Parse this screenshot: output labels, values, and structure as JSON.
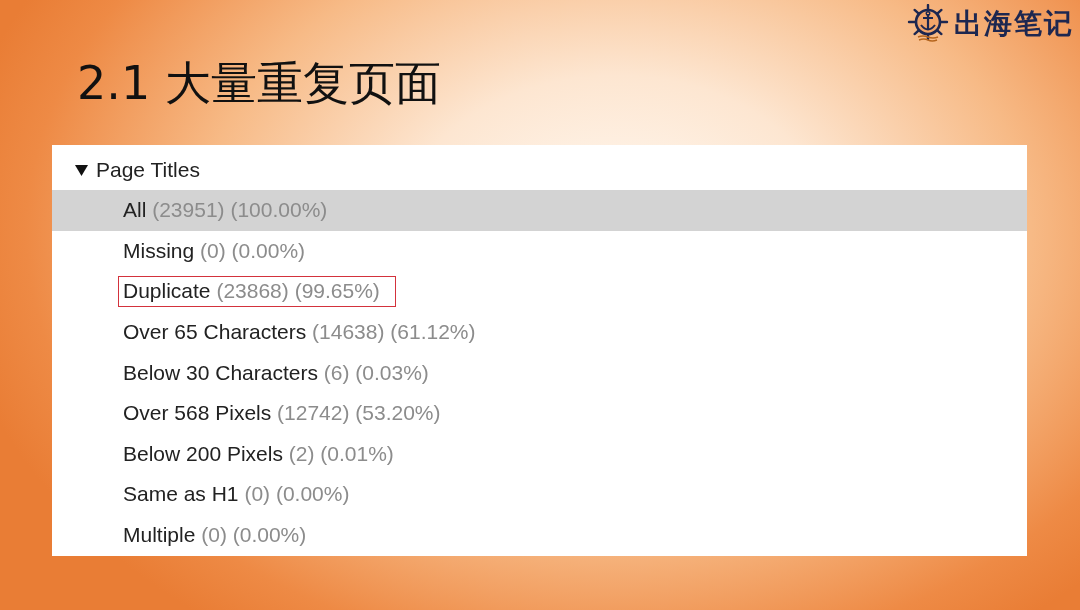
{
  "logo": {
    "text": "出海笔记"
  },
  "slide_title": "2.1 大量重复页面",
  "tree": {
    "label": "Page Titles",
    "expanded": true,
    "children": [
      {
        "label": "All",
        "count": "(23951)",
        "percent": "(100.00%)",
        "selected": true,
        "annotated": false
      },
      {
        "label": "Missing",
        "count": "(0)",
        "percent": "(0.00%)",
        "selected": false,
        "annotated": false
      },
      {
        "label": "Duplicate",
        "count": "(23868)",
        "percent": "(99.65%)",
        "selected": false,
        "annotated": true
      },
      {
        "label": "Over 65 Characters",
        "count": "(14638)",
        "percent": "(61.12%)",
        "selected": false,
        "annotated": false
      },
      {
        "label": "Below 30 Characters",
        "count": "(6)",
        "percent": "(0.03%)",
        "selected": false,
        "annotated": false
      },
      {
        "label": "Over 568 Pixels",
        "count": "(12742)",
        "percent": "(53.20%)",
        "selected": false,
        "annotated": false
      },
      {
        "label": "Below 200 Pixels",
        "count": "(2)",
        "percent": "(0.01%)",
        "selected": false,
        "annotated": false
      },
      {
        "label": "Same as H1",
        "count": "(0)",
        "percent": "(0.00%)",
        "selected": false,
        "annotated": false
      },
      {
        "label": "Multiple",
        "count": "(0)",
        "percent": "(0.00%)",
        "selected": false,
        "annotated": false
      }
    ]
  }
}
